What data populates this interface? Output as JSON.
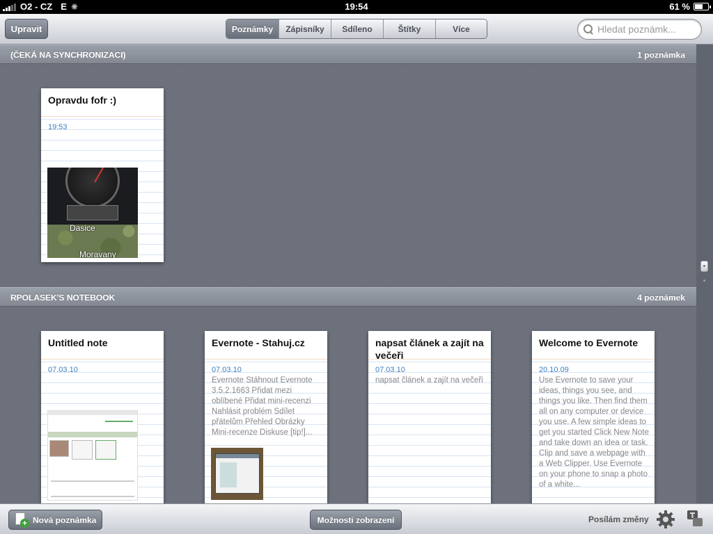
{
  "statusbar": {
    "carrier": "O2 - CZ",
    "network": "E",
    "time": "19:54",
    "battery": "61 %",
    "battery_level": 0.61
  },
  "toolbar": {
    "edit_label": "Upravit",
    "tabs": [
      {
        "label": "Poznámky",
        "active": true
      },
      {
        "label": "Zápisníky",
        "active": false
      },
      {
        "label": "Sdíleno",
        "active": false
      },
      {
        "label": "Štítky",
        "active": false
      },
      {
        "label": "Více",
        "active": false
      }
    ],
    "search_placeholder": "Hledat poznámk..."
  },
  "sections": [
    {
      "title": "(ČEKÁ NA SYNCHRONIZACI)",
      "count": "1 poznámka",
      "notes": [
        {
          "title": "Opravdu fofr :)",
          "date": "19:53",
          "snippet": "",
          "thumbnail": "gps-app-screenshot",
          "thumb_labels": [
            "Dasice",
            "Moravany"
          ]
        }
      ]
    },
    {
      "title": "RPOLASEK'S NOTEBOOK",
      "count": "4 poznámek",
      "notes": [
        {
          "title": "Untitled note",
          "date": "07.03.10",
          "snippet": "",
          "thumbnail": "webpage-screenshot"
        },
        {
          "title": "Evernote - Stahuj.cz",
          "date": "07.03.10",
          "snippet": "Evernote Stáhnout Evernote 3.5.2.1663 Přidat mezi oblíbené Přidat mini-recenzi Nahlásit problém Sdílet přátelům Přehled Obrázky Mini-recenze Diskuse [tip!]...",
          "thumbnail": "desktop-screenshot"
        },
        {
          "title": "napsat článek a zajít na večeři",
          "date": "07.03.10",
          "snippet": "napsat článek a zajít na večeři",
          "thumbnail": ""
        },
        {
          "title": "Welcome to Evernote",
          "date": "20.10.09",
          "snippet": "Use Evernote to save your ideas, things you see, and things you like. Then find them all on any computer or device you use. A few simple ideas to get you started Click New Note and take down an idea or task. Clip and save a webpage with a Web Clipper. Use Evernote on your phone to snap a photo of a white...",
          "thumbnail": ""
        }
      ]
    }
  ],
  "bottombar": {
    "new_note_label": "Nová poznámka",
    "options_label": "Možnosti zobrazení",
    "sync_status": "Posílám změny"
  },
  "icons": {
    "search": "search-icon",
    "new_note": "new-note-icon",
    "settings": "gear-icon",
    "account": "user-icon"
  }
}
